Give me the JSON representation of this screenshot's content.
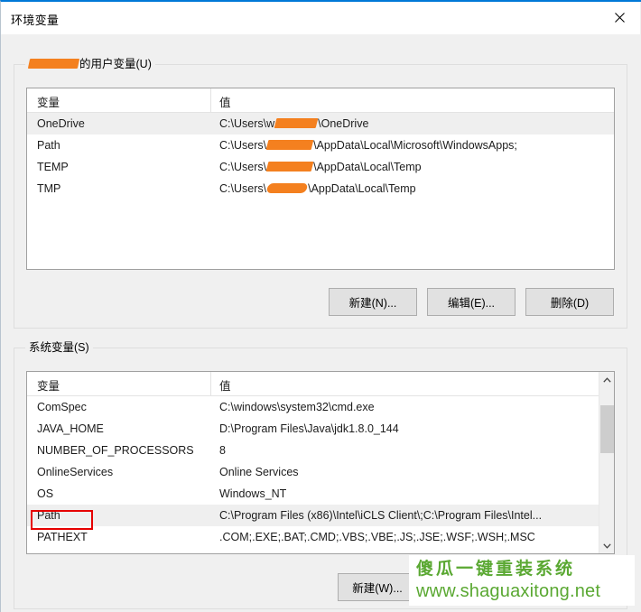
{
  "window": {
    "title": "环境变量",
    "close_label": "×"
  },
  "user_section": {
    "legend_suffix": "的用户变量(U)",
    "redacted_username": true,
    "columns": [
      "变量",
      "值"
    ],
    "rows": [
      {
        "name": "OneDrive",
        "value_prefix": "C:\\Users\\w",
        "value_suffix": "\\OneDrive",
        "redact_width": "w1",
        "selected": true
      },
      {
        "name": "Path",
        "value_prefix": "C:\\Users\\",
        "value_suffix": "\\AppData\\Local\\Microsoft\\WindowsApps;",
        "redact_width": "w2",
        "selected": false
      },
      {
        "name": "TEMP",
        "value_prefix": "C:\\Users\\",
        "value_suffix": "\\AppData\\Local\\Temp",
        "redact_width": "w3",
        "selected": false
      },
      {
        "name": "TMP",
        "value_prefix": "C:\\Users\\",
        "value_suffix": "\\AppData\\Local\\Temp",
        "redact_width": "w4",
        "selected": false
      }
    ],
    "buttons": {
      "new": "新建(N)...",
      "edit": "编辑(E)...",
      "delete": "删除(D)"
    }
  },
  "system_section": {
    "legend": "系统变量(S)",
    "columns": [
      "变量",
      "值"
    ],
    "rows": [
      {
        "name": "ComSpec",
        "value": "C:\\windows\\system32\\cmd.exe",
        "selected": false
      },
      {
        "name": "JAVA_HOME",
        "value": "D:\\Program Files\\Java\\jdk1.8.0_144",
        "selected": false
      },
      {
        "name": "NUMBER_OF_PROCESSORS",
        "value": "8",
        "selected": false
      },
      {
        "name": "OnlineServices",
        "value": "Online Services",
        "selected": false
      },
      {
        "name": "OS",
        "value": "Windows_NT",
        "selected": false
      },
      {
        "name": "Path",
        "value": "C:\\Program Files (x86)\\Intel\\iCLS Client\\;C:\\Program Files\\Intel...",
        "selected": true
      },
      {
        "name": "PATHEXT",
        "value": ".COM;.EXE;.BAT;.CMD;.VBS;.VBE;.JS;.JSE;.WSF;.WSH;.MSC",
        "selected": false
      }
    ],
    "buttons": {
      "new": "新建(W)..."
    },
    "scrollbar": {
      "up_icon": "chevron-up-icon",
      "down_icon": "chevron-down-icon"
    }
  },
  "annotation": {
    "target": "Path",
    "color": "#e60000"
  },
  "watermark": {
    "line1": "傻瓜一键重装系统",
    "line2": "www.shaguaxitong.net",
    "color": "#5aa832"
  },
  "colors": {
    "accent": "#0078d7",
    "redaction": "#f4801f",
    "selection": "#efefef",
    "dialog_bg": "#f0f0f0"
  }
}
